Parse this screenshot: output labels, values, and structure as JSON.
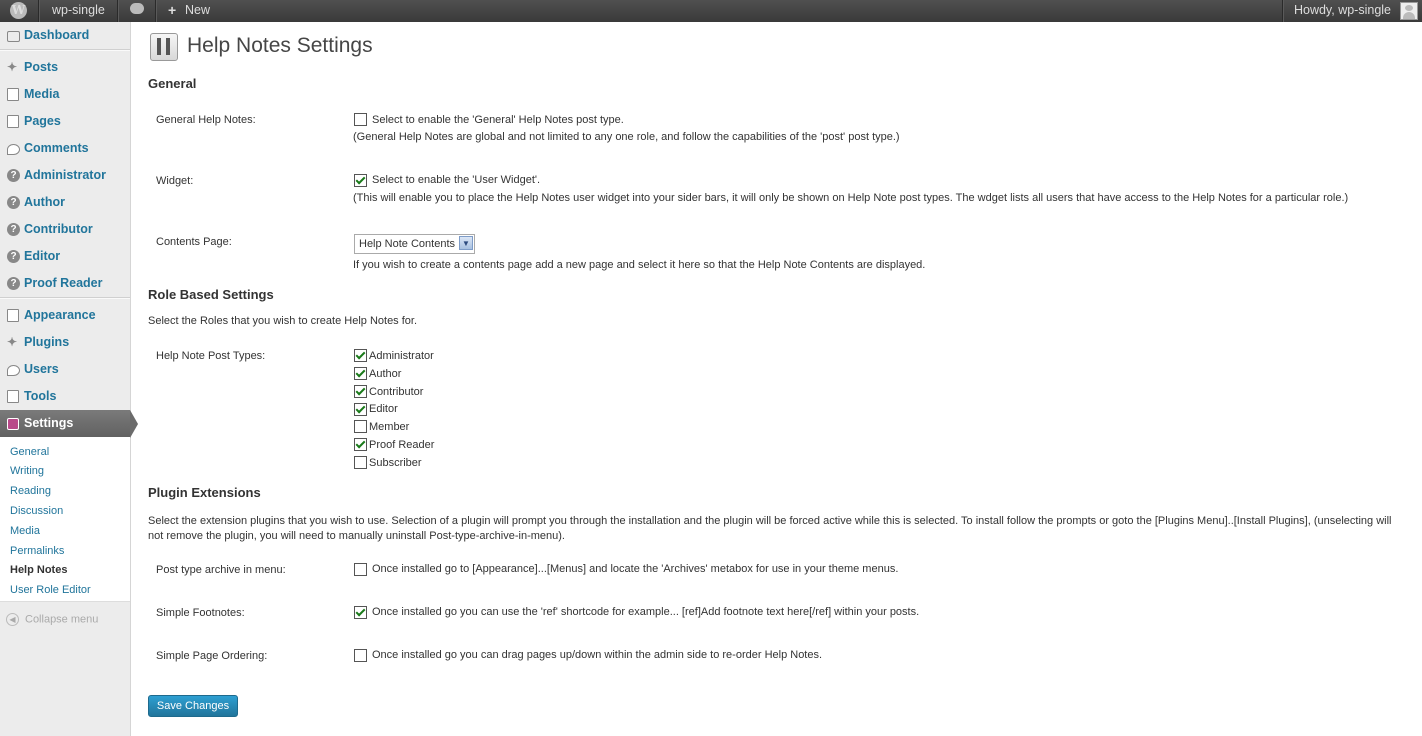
{
  "adminbar": {
    "site_name": "wp-single",
    "new_label": "New",
    "howdy": "Howdy, wp-single"
  },
  "sidebar": {
    "items": [
      {
        "label": "Dashboard"
      },
      {
        "label": "Posts"
      },
      {
        "label": "Media"
      },
      {
        "label": "Pages"
      },
      {
        "label": "Comments"
      },
      {
        "label": "Administrator"
      },
      {
        "label": "Author"
      },
      {
        "label": "Contributor"
      },
      {
        "label": "Editor"
      },
      {
        "label": "Proof Reader"
      },
      {
        "label": "Appearance"
      },
      {
        "label": "Plugins"
      },
      {
        "label": "Users"
      },
      {
        "label": "Tools"
      },
      {
        "label": "Settings"
      }
    ],
    "submenu": [
      {
        "label": "General"
      },
      {
        "label": "Writing"
      },
      {
        "label": "Reading"
      },
      {
        "label": "Discussion"
      },
      {
        "label": "Media"
      },
      {
        "label": "Permalinks"
      },
      {
        "label": "Help Notes"
      },
      {
        "label": "User Role Editor"
      }
    ],
    "collapse_label": "Collapse menu"
  },
  "page": {
    "title": "Help Notes Settings",
    "general": {
      "heading": "General",
      "general_help_notes": {
        "label": "General Help Notes:",
        "checked": false,
        "text": "Select to enable the 'General' Help Notes post type.",
        "note": "(General Help Notes are global and not limited to any one role, and follow the capabilities of the 'post' post type.)"
      },
      "widget": {
        "label": "Widget:",
        "checked": true,
        "text": "Select to enable the 'User Widget'.",
        "note": "(This will enable you to place the Help Notes user widget into your sider bars, it will only be shown on Help Note post types. The wdget lists all users that have access to the Help Notes for a particular role.)"
      },
      "contents_page": {
        "label": "Contents Page:",
        "selected": "Help Note Contents",
        "note": "If you wish to create a contents page add a new page and select it here so that the Help Note Contents are displayed."
      }
    },
    "roles": {
      "heading": "Role Based Settings",
      "intro": "Select the Roles that you wish to create Help Notes for.",
      "label": "Help Note Post Types:",
      "options": [
        {
          "label": "Administrator",
          "checked": true
        },
        {
          "label": "Author",
          "checked": true
        },
        {
          "label": "Contributor",
          "checked": true
        },
        {
          "label": "Editor",
          "checked": true
        },
        {
          "label": "Member",
          "checked": false
        },
        {
          "label": "Proof Reader",
          "checked": true
        },
        {
          "label": "Subscriber",
          "checked": false
        }
      ]
    },
    "extensions": {
      "heading": "Plugin Extensions",
      "intro": "Select the extension plugins that you wish to use. Selection of a plugin will prompt you through the installation and the plugin will be forced active while this is selected. To install follow the prompts or goto the [Plugins Menu]..[Install Plugins], (unselecting will not remove the plugin, you will need to manually uninstall Post-type-archive-in-menu).",
      "items": [
        {
          "label": "Post type archive in menu:",
          "checked": false,
          "text": "Once installed go to [Appearance]...[Menus] and locate the 'Archives' metabox for use in your theme menus."
        },
        {
          "label": "Simple Footnotes:",
          "checked": true,
          "text": "Once installed go you can use the 'ref' shortcode for example... [ref]Add footnote text here[/ref] within your posts."
        },
        {
          "label": "Simple Page Ordering:",
          "checked": false,
          "text": "Once installed go you can drag pages up/down within the admin side to re-order Help Notes."
        }
      ]
    },
    "save_label": "Save Changes"
  }
}
